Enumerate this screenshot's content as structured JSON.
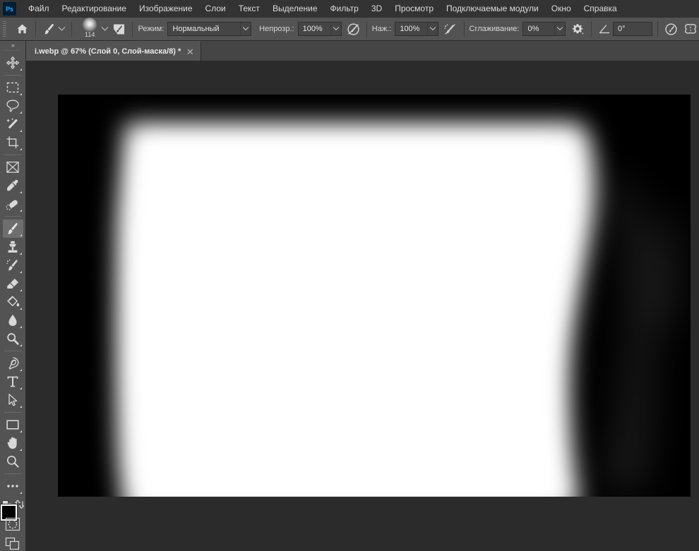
{
  "app": {
    "name": "Adobe Photoshop",
    "logo_text": "Ps"
  },
  "menubar": {
    "items": [
      {
        "label": "Файл",
        "name": "menu-file"
      },
      {
        "label": "Редактирование",
        "name": "menu-edit"
      },
      {
        "label": "Изображение",
        "name": "menu-image"
      },
      {
        "label": "Слои",
        "name": "menu-layers"
      },
      {
        "label": "Текст",
        "name": "menu-type"
      },
      {
        "label": "Выделение",
        "name": "menu-select"
      },
      {
        "label": "Фильтр",
        "name": "menu-filter"
      },
      {
        "label": "3D",
        "name": "menu-3d"
      },
      {
        "label": "Просмотр",
        "name": "menu-view"
      },
      {
        "label": "Подключаемые модули",
        "name": "menu-plugins"
      },
      {
        "label": "Окно",
        "name": "menu-window"
      },
      {
        "label": "Справка",
        "name": "menu-help"
      }
    ]
  },
  "options_bar": {
    "home_icon": "home-icon",
    "tool_icon": "brush-tool-icon",
    "brush_size": "114",
    "brush_panel_icon": "brush-settings-panel-icon",
    "mode_label": "Режим:",
    "mode_value": "Нормальный",
    "opacity_label": "Непрозр.:",
    "opacity_value": "100%",
    "opacity_pressure_icon": "pressure-opacity-icon",
    "flow_label": "Наж.:",
    "flow_value": "100%",
    "airbrush_icon": "airbrush-icon",
    "smoothing_label": "Сглаживание:",
    "smoothing_value": "0%",
    "smoothing_gear_icon": "smoothing-options-gear-icon",
    "angle_icon": "brush-angle-icon",
    "angle_value": "0°",
    "pressure_size_icon": "pressure-size-icon",
    "symmetry_icon": "symmetry-butterfly-icon"
  },
  "tabbar": {
    "tab_title": "i.webp @ 67% (Слой 0, Слой-маска/8) *",
    "close_glyph": "✕"
  },
  "toolbar": {
    "expand_glyph": "»",
    "tools": [
      {
        "name": "tool-move",
        "icon": "move-icon",
        "has_submenu": true,
        "active": false
      },
      {
        "name": "tool-rect-marquee",
        "icon": "marquee-icon",
        "has_submenu": true,
        "active": false
      },
      {
        "name": "tool-lasso",
        "icon": "lasso-icon",
        "has_submenu": true,
        "active": false
      },
      {
        "name": "tool-magic-wand",
        "icon": "magic-wand-icon",
        "has_submenu": true,
        "active": false
      },
      {
        "name": "tool-crop",
        "icon": "crop-icon",
        "has_submenu": true,
        "active": false
      },
      {
        "name": "tool-frame",
        "icon": "frame-icon",
        "has_submenu": false,
        "active": false
      },
      {
        "name": "tool-eyedropper",
        "icon": "eyedropper-icon",
        "has_submenu": true,
        "active": false
      },
      {
        "name": "tool-spot-healing",
        "icon": "healing-brush-icon",
        "has_submenu": true,
        "active": false
      },
      {
        "name": "tool-brush",
        "icon": "brush-icon",
        "has_submenu": true,
        "active": true
      },
      {
        "name": "tool-clone-stamp",
        "icon": "clone-stamp-icon",
        "has_submenu": true,
        "active": false
      },
      {
        "name": "tool-history-brush",
        "icon": "history-brush-icon",
        "has_submenu": true,
        "active": false
      },
      {
        "name": "tool-eraser",
        "icon": "eraser-icon",
        "has_submenu": true,
        "active": false
      },
      {
        "name": "tool-gradient",
        "icon": "paint-bucket-icon",
        "has_submenu": true,
        "active": false
      },
      {
        "name": "tool-blur",
        "icon": "blur-icon",
        "has_submenu": true,
        "active": false
      },
      {
        "name": "tool-dodge",
        "icon": "dodge-icon",
        "has_submenu": true,
        "active": false
      },
      {
        "name": "tool-pen",
        "icon": "pen-icon",
        "has_submenu": true,
        "active": false
      },
      {
        "name": "tool-type",
        "icon": "type-icon",
        "has_submenu": true,
        "active": false
      },
      {
        "name": "tool-path-selection",
        "icon": "path-selection-icon",
        "has_submenu": true,
        "active": false
      },
      {
        "name": "tool-rectangle",
        "icon": "rectangle-shape-icon",
        "has_submenu": true,
        "active": false
      },
      {
        "name": "tool-hand",
        "icon": "hand-icon",
        "has_submenu": true,
        "active": false
      },
      {
        "name": "tool-zoom",
        "icon": "zoom-magnifier-icon",
        "has_submenu": false,
        "active": false
      },
      {
        "name": "tool-edit-toolbar",
        "icon": "more-tools-ellipsis-icon",
        "has_submenu": true,
        "active": false
      }
    ],
    "default_colors_icon": "default-colors-icon",
    "swap_colors_icon": "swap-colors-icon",
    "foreground_color": "#000000",
    "background_color": "#000000",
    "quick_mask_icon": "quick-mask-icon",
    "screen_mode_icon": "screen-mode-icon"
  },
  "canvas": {
    "zoom": "67%",
    "document_name": "i.webp",
    "view": "layer-mask",
    "mask_background": "#000000",
    "mask_foreground": "#ffffff",
    "workspace_background": "#2b2b2b"
  }
}
